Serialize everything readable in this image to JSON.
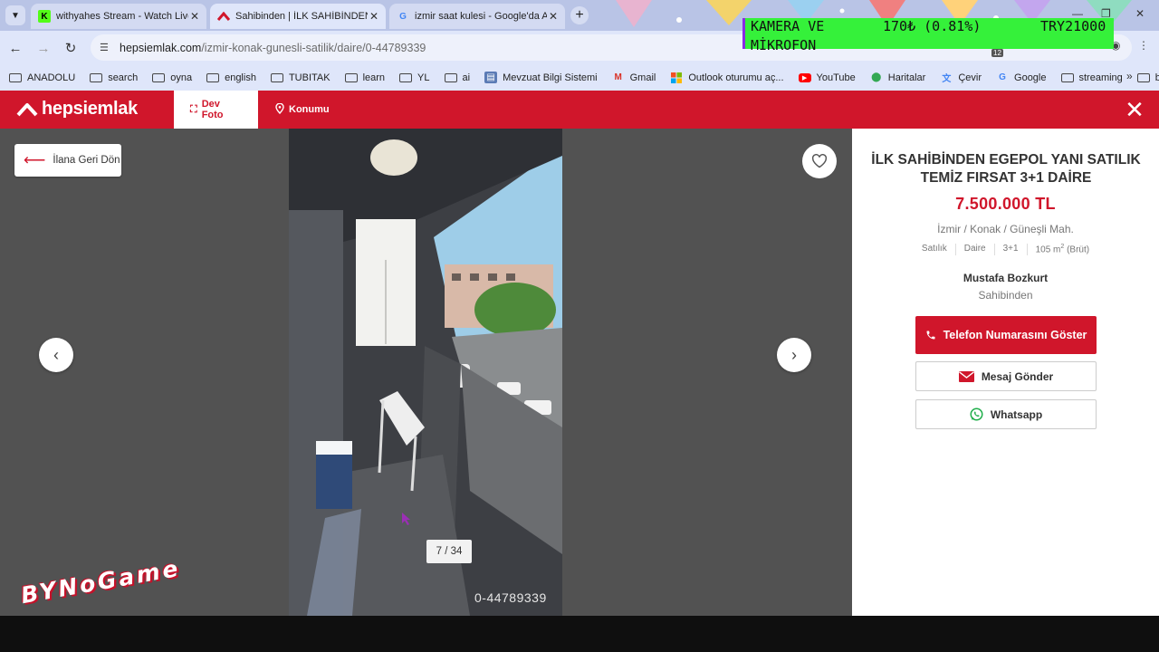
{
  "browser": {
    "tabs": [
      {
        "title": "withyahes Stream - Watch Live",
        "favicon": "kick-logo",
        "active": false
      },
      {
        "title": "Sahibinden | İLK SAHİBİNDEN E",
        "favicon": "hepsiemlak-logo",
        "active": true
      },
      {
        "title": "izmir saat kulesi - Google'da Ar",
        "favicon": "google-logo",
        "active": false
      }
    ],
    "url_host": "hepsiemlak.com",
    "url_path": "/izmir-konak-gunesli-satilik/daire/0-44789339",
    "extension_badge": "12",
    "bookmarks": [
      {
        "label": "ANADOLU",
        "icon": "folder-icon"
      },
      {
        "label": "search",
        "icon": "folder-icon"
      },
      {
        "label": "oyna",
        "icon": "folder-icon"
      },
      {
        "label": "english",
        "icon": "folder-icon"
      },
      {
        "label": "TUBITAK",
        "icon": "folder-icon"
      },
      {
        "label": "learn",
        "icon": "folder-icon"
      },
      {
        "label": "YL",
        "icon": "folder-icon"
      },
      {
        "label": "ai",
        "icon": "folder-icon"
      },
      {
        "label": "Mevzuat Bilgi Sistemi",
        "icon": "mevzuat-icon"
      },
      {
        "label": "Gmail",
        "icon": "gmail-icon"
      },
      {
        "label": "Outlook oturumu aç...",
        "icon": "microsoft-icon"
      },
      {
        "label": "YouTube",
        "icon": "youtube-icon"
      },
      {
        "label": "Haritalar",
        "icon": "maps-icon"
      },
      {
        "label": "Çevir",
        "icon": "translate-icon"
      },
      {
        "label": "Google",
        "icon": "google-icon"
      },
      {
        "label": "streaming",
        "icon": "folder-icon"
      },
      {
        "label": "basvur",
        "icon": "folder-icon"
      }
    ]
  },
  "stream_overlay": {
    "line1": "KAMERA VE",
    "line2": "MİKROFON",
    "middle": "170₺ (0.81%)",
    "right": "TRY21000"
  },
  "header": {
    "logo": "hepsiemlak",
    "tabs": [
      {
        "label": "Dev Foto",
        "icon": "expand-icon",
        "active": true
      },
      {
        "label": "Konumu",
        "icon": "location-pin-icon",
        "active": false
      }
    ]
  },
  "gallery": {
    "back_label": "İlana Geri Dön",
    "counter": "7 / 34",
    "listing_id": "0-44789339"
  },
  "listing": {
    "title": "İLK SAHİBİNDEN EGEPOL YANI SATILIK TEMİZ FIRSAT 3+1 DAİRE",
    "price": "7.500.000  TL",
    "location": "İzmir / Konak / Güneşli Mah.",
    "meta": {
      "type": "Satılık",
      "category": "Daire",
      "rooms": "3+1",
      "area_value": "105 m",
      "area_sup": "2",
      "area_note": " (Brüt)"
    },
    "owner_name": "Mustafa Bozkurt",
    "owner_type": "Sahibinden",
    "phone_button": "Telefon Numarasını Göster",
    "message_button": "Mesaj Gönder",
    "whatsapp_button": "Whatsapp"
  },
  "watermark": "BYNoGame",
  "colors": {
    "brand": "#d0162b",
    "gallery_bg": "#525252",
    "whatsapp": "#25d366"
  }
}
